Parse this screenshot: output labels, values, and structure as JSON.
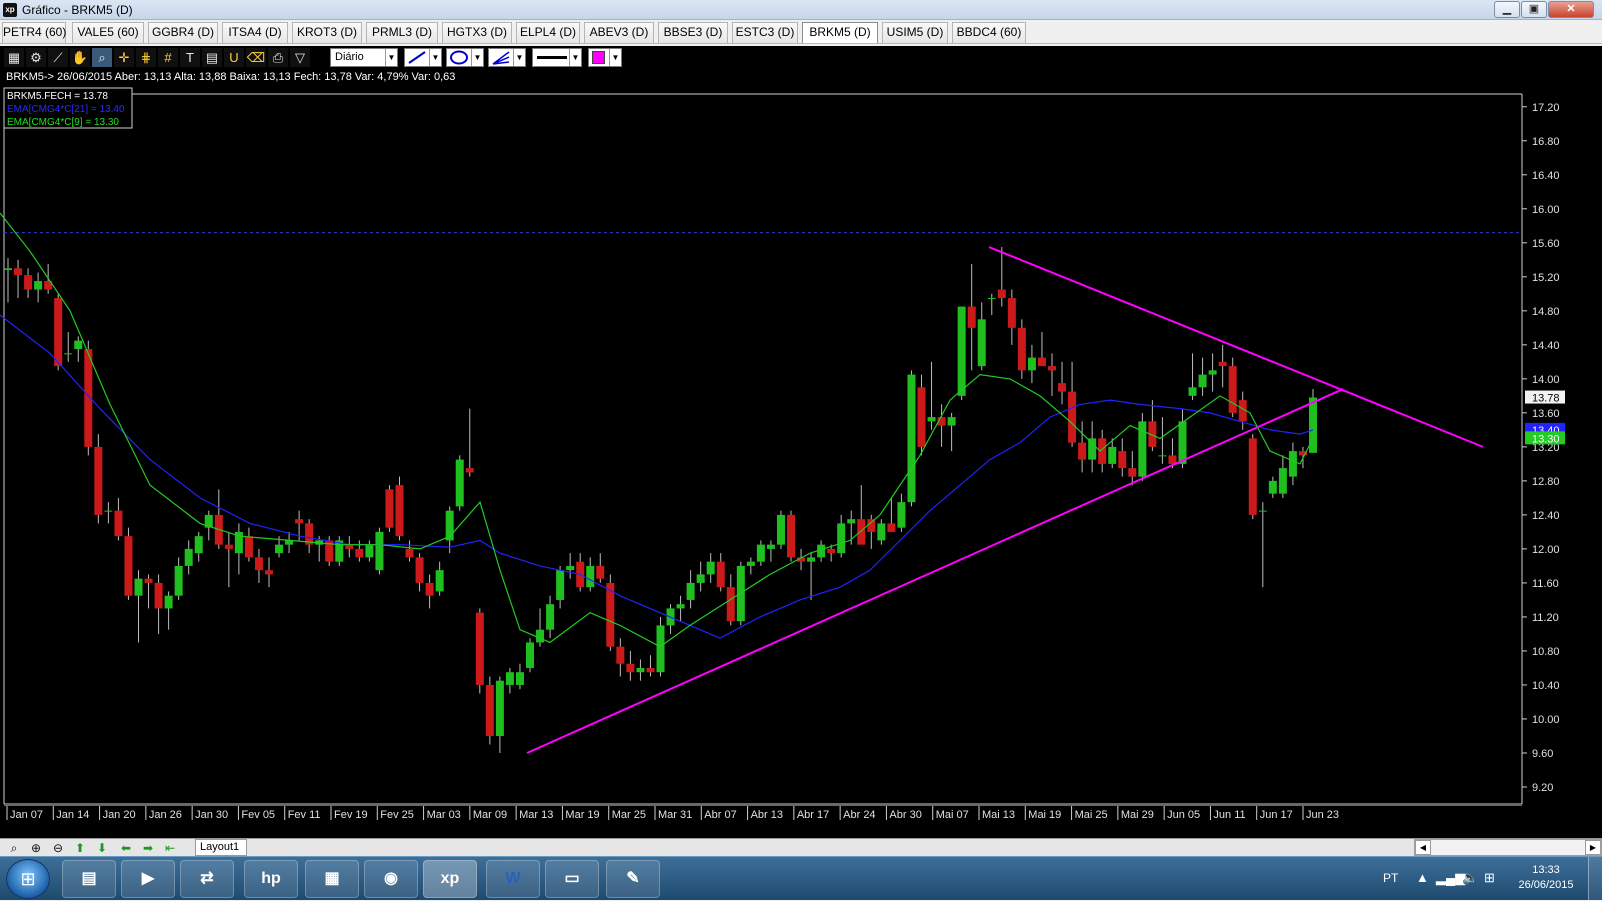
{
  "window": {
    "app_icon_text": "xp",
    "title": "Gráfico - BRKM5 (D)",
    "min_icon": "minimize-icon",
    "max_icon": "maximize-icon",
    "close_icon": "close-icon"
  },
  "tabs": [
    {
      "label": "PETR4 (60)",
      "active": false
    },
    {
      "label": "VALE5 (60)",
      "active": false
    },
    {
      "label": "GGBR4 (D)",
      "active": false
    },
    {
      "label": "ITSA4 (D)",
      "active": false
    },
    {
      "label": "KROT3 (D)",
      "active": false
    },
    {
      "label": "PRML3 (D)",
      "active": false
    },
    {
      "label": "HGTX3 (D)",
      "active": false
    },
    {
      "label": "ELPL4 (D)",
      "active": false
    },
    {
      "label": "ABEV3 (D)",
      "active": false
    },
    {
      "label": "BBSE3 (D)",
      "active": false
    },
    {
      "label": "ESTC3 (D)",
      "active": false
    },
    {
      "label": "BRKM5 (D)",
      "active": true
    },
    {
      "label": "USIM5 (D)",
      "active": false
    },
    {
      "label": "BBDC4 (60)",
      "active": false
    }
  ],
  "toolbar": {
    "period_value": "Diário",
    "line_color": "#ff00ff"
  },
  "info_bar": {
    "text": "BRKM5-> 26/06/2015 Aber: 13,13 Alta: 13,88 Baixa: 13,13 Fech: 13,78 Var: 4,79% Var: 0,63"
  },
  "legend": {
    "items": [
      {
        "text": "BRKM5.FECH = 13.78",
        "color": "#ffffff"
      },
      {
        "text": "EMA[CMG4*C[21] = 13.40",
        "color": "#2b2bff"
      },
      {
        "text": "EMA[CMG4*C[9] = 13.30",
        "color": "#22dd22"
      }
    ]
  },
  "chart_data": {
    "type": "candlestick",
    "symbol": "BRKM5",
    "period": "Diário",
    "ylim": [
      9.0,
      17.35
    ],
    "y_ticks": [
      "17.20",
      "16.80",
      "16.40",
      "16.00",
      "15.60",
      "15.20",
      "14.80",
      "14.40",
      "14.00",
      "13.60",
      "13.20",
      "12.80",
      "12.40",
      "12.00",
      "11.60",
      "11.20",
      "10.80",
      "10.40",
      "10.00",
      "9.60",
      "9.20"
    ],
    "x_labels": [
      "Jan 07",
      "Jan 14",
      "Jan 20",
      "Jan 26",
      "Jan 30",
      "Fev 05",
      "Fev 11",
      "Fev 19",
      "Fev 25",
      "Mar 03",
      "Mar 09",
      "Mar 13",
      "Mar 19",
      "Mar 25",
      "Mar 31",
      "Abr 07",
      "Abr 13",
      "Abr 17",
      "Abr 24",
      "Abr 30",
      "Mai 07",
      "Mai 13",
      "Mai 19",
      "Mai 25",
      "Mai 29",
      "Jun 05",
      "Jun 11",
      "Jun 17",
      "Jun 23"
    ],
    "colors": {
      "up": "#1fbf1f",
      "down": "#cc1a1a",
      "ema21": "#2222ff",
      "ema9": "#22cc22",
      "trendline": "#ff00ff",
      "hline": "#2b3fcf"
    },
    "last_close": "13.78",
    "ema21_label": "13.40",
    "ema9_label": "13.30",
    "resistance_level": 15.72,
    "candles": [
      {
        "o": 15.28,
        "h": 15.42,
        "l": 14.9,
        "c": 15.3
      },
      {
        "o": 15.3,
        "h": 15.4,
        "l": 14.95,
        "c": 15.22
      },
      {
        "o": 15.22,
        "h": 15.3,
        "l": 14.95,
        "c": 15.05
      },
      {
        "o": 15.05,
        "h": 15.25,
        "l": 14.9,
        "c": 15.15
      },
      {
        "o": 15.15,
        "h": 15.35,
        "l": 15.0,
        "c": 15.05
      },
      {
        "o": 14.95,
        "h": 15.0,
        "l": 14.1,
        "c": 14.15
      },
      {
        "o": 14.3,
        "h": 14.55,
        "l": 14.2,
        "c": 14.3
      },
      {
        "o": 14.35,
        "h": 14.5,
        "l": 14.2,
        "c": 14.45
      },
      {
        "o": 14.35,
        "h": 14.45,
        "l": 13.1,
        "c": 13.2
      },
      {
        "o": 13.2,
        "h": 13.35,
        "l": 12.3,
        "c": 12.4
      },
      {
        "o": 12.45,
        "h": 12.55,
        "l": 12.3,
        "c": 12.45
      },
      {
        "o": 12.45,
        "h": 12.6,
        "l": 12.1,
        "c": 12.15
      },
      {
        "o": 12.15,
        "h": 12.25,
        "l": 11.4,
        "c": 11.45
      },
      {
        "o": 11.45,
        "h": 11.75,
        "l": 10.9,
        "c": 11.65
      },
      {
        "o": 11.65,
        "h": 11.7,
        "l": 11.3,
        "c": 11.6
      },
      {
        "o": 11.6,
        "h": 11.7,
        "l": 11.0,
        "c": 11.3
      },
      {
        "o": 11.3,
        "h": 11.5,
        "l": 11.05,
        "c": 11.45
      },
      {
        "o": 11.45,
        "h": 11.9,
        "l": 11.4,
        "c": 11.8
      },
      {
        "o": 11.8,
        "h": 12.1,
        "l": 11.7,
        "c": 12.0
      },
      {
        "o": 11.95,
        "h": 12.2,
        "l": 11.85,
        "c": 12.15
      },
      {
        "o": 12.25,
        "h": 12.45,
        "l": 12.1,
        "c": 12.4
      },
      {
        "o": 12.4,
        "h": 12.7,
        "l": 12.0,
        "c": 12.05
      },
      {
        "o": 12.05,
        "h": 12.2,
        "l": 11.55,
        "c": 12.0
      },
      {
        "o": 11.95,
        "h": 12.3,
        "l": 11.7,
        "c": 12.2
      },
      {
        "o": 12.15,
        "h": 12.25,
        "l": 11.85,
        "c": 11.9
      },
      {
        "o": 11.9,
        "h": 12.0,
        "l": 11.6,
        "c": 11.75
      },
      {
        "o": 11.75,
        "h": 11.9,
        "l": 11.55,
        "c": 11.7
      },
      {
        "o": 11.95,
        "h": 12.15,
        "l": 11.9,
        "c": 12.05
      },
      {
        "o": 12.05,
        "h": 12.2,
        "l": 11.95,
        "c": 12.1
      },
      {
        "o": 12.35,
        "h": 12.45,
        "l": 12.1,
        "c": 12.3
      },
      {
        "o": 12.3,
        "h": 12.35,
        "l": 11.95,
        "c": 12.05
      },
      {
        "o": 12.05,
        "h": 12.15,
        "l": 11.85,
        "c": 12.1
      },
      {
        "o": 12.1,
        "h": 12.15,
        "l": 11.8,
        "c": 11.85
      },
      {
        "o": 11.85,
        "h": 12.15,
        "l": 11.8,
        "c": 12.1
      },
      {
        "o": 12.05,
        "h": 12.15,
        "l": 11.9,
        "c": 12.0
      },
      {
        "o": 12.0,
        "h": 12.1,
        "l": 11.85,
        "c": 11.9
      },
      {
        "o": 11.9,
        "h": 12.1,
        "l": 11.85,
        "c": 12.05
      },
      {
        "o": 11.75,
        "h": 12.25,
        "l": 11.7,
        "c": 12.2
      },
      {
        "o": 12.7,
        "h": 12.75,
        "l": 12.2,
        "c": 12.25
      },
      {
        "o": 12.75,
        "h": 12.85,
        "l": 12.1,
        "c": 12.15
      },
      {
        "o": 12.0,
        "h": 12.1,
        "l": 11.85,
        "c": 11.9
      },
      {
        "o": 11.9,
        "h": 11.95,
        "l": 11.5,
        "c": 11.6
      },
      {
        "o": 11.6,
        "h": 11.7,
        "l": 11.3,
        "c": 11.45
      },
      {
        "o": 11.5,
        "h": 11.85,
        "l": 11.45,
        "c": 11.75
      },
      {
        "o": 12.1,
        "h": 12.5,
        "l": 11.95,
        "c": 12.45
      },
      {
        "o": 12.5,
        "h": 13.1,
        "l": 12.45,
        "c": 13.05
      },
      {
        "o": 12.95,
        "h": 13.65,
        "l": 12.85,
        "c": 12.9
      },
      {
        "o": 11.25,
        "h": 11.3,
        "l": 10.3,
        "c": 10.4
      },
      {
        "o": 10.4,
        "h": 10.5,
        "l": 9.7,
        "c": 9.8
      },
      {
        "o": 9.8,
        "h": 10.5,
        "l": 9.6,
        "c": 10.45
      },
      {
        "o": 10.4,
        "h": 10.6,
        "l": 10.3,
        "c": 10.55
      },
      {
        "o": 10.4,
        "h": 10.65,
        "l": 10.35,
        "c": 10.55
      },
      {
        "o": 10.6,
        "h": 10.95,
        "l": 10.55,
        "c": 10.9
      },
      {
        "o": 10.9,
        "h": 11.3,
        "l": 10.85,
        "c": 11.05
      },
      {
        "o": 11.05,
        "h": 11.45,
        "l": 10.95,
        "c": 11.35
      },
      {
        "o": 11.4,
        "h": 11.8,
        "l": 11.3,
        "c": 11.75
      },
      {
        "o": 11.75,
        "h": 11.95,
        "l": 11.65,
        "c": 11.8
      },
      {
        "o": 11.85,
        "h": 11.95,
        "l": 11.5,
        "c": 11.55
      },
      {
        "o": 11.55,
        "h": 11.9,
        "l": 11.5,
        "c": 11.8
      },
      {
        "o": 11.8,
        "h": 11.95,
        "l": 11.6,
        "c": 11.65
      },
      {
        "o": 11.6,
        "h": 11.7,
        "l": 10.8,
        "c": 10.85
      },
      {
        "o": 10.85,
        "h": 10.95,
        "l": 10.5,
        "c": 10.65
      },
      {
        "o": 10.65,
        "h": 10.8,
        "l": 10.45,
        "c": 10.55
      },
      {
        "o": 10.55,
        "h": 10.7,
        "l": 10.45,
        "c": 10.6
      },
      {
        "o": 10.6,
        "h": 10.75,
        "l": 10.5,
        "c": 10.55
      },
      {
        "o": 10.55,
        "h": 11.2,
        "l": 10.5,
        "c": 11.1
      },
      {
        "o": 11.1,
        "h": 11.35,
        "l": 11.0,
        "c": 11.3
      },
      {
        "o": 11.3,
        "h": 11.45,
        "l": 11.15,
        "c": 11.35
      },
      {
        "o": 11.4,
        "h": 11.75,
        "l": 11.3,
        "c": 11.6
      },
      {
        "o": 11.6,
        "h": 11.85,
        "l": 11.5,
        "c": 11.7
      },
      {
        "o": 11.7,
        "h": 11.95,
        "l": 11.6,
        "c": 11.85
      },
      {
        "o": 11.85,
        "h": 11.95,
        "l": 11.5,
        "c": 11.55
      },
      {
        "o": 11.55,
        "h": 11.7,
        "l": 11.1,
        "c": 11.15
      },
      {
        "o": 11.15,
        "h": 11.85,
        "l": 11.1,
        "c": 11.8
      },
      {
        "o": 11.8,
        "h": 11.9,
        "l": 11.7,
        "c": 11.85
      },
      {
        "o": 11.85,
        "h": 12.1,
        "l": 11.8,
        "c": 12.05
      },
      {
        "o": 12.0,
        "h": 12.1,
        "l": 11.85,
        "c": 12.05
      },
      {
        "o": 12.05,
        "h": 12.45,
        "l": 12.0,
        "c": 12.4
      },
      {
        "o": 12.4,
        "h": 12.45,
        "l": 11.85,
        "c": 11.9
      },
      {
        "o": 11.9,
        "h": 12.0,
        "l": 11.75,
        "c": 11.85
      },
      {
        "o": 11.85,
        "h": 11.95,
        "l": 11.4,
        "c": 11.9
      },
      {
        "o": 11.9,
        "h": 12.1,
        "l": 11.85,
        "c": 12.05
      },
      {
        "o": 12.0,
        "h": 12.05,
        "l": 11.85,
        "c": 11.95
      },
      {
        "o": 11.95,
        "h": 12.4,
        "l": 11.9,
        "c": 12.3
      },
      {
        "o": 12.3,
        "h": 12.45,
        "l": 12.05,
        "c": 12.35
      },
      {
        "o": 12.35,
        "h": 12.75,
        "l": 12.3,
        "c": 12.05
      },
      {
        "o": 12.35,
        "h": 12.4,
        "l": 12.0,
        "c": 12.2
      },
      {
        "o": 12.1,
        "h": 12.35,
        "l": 12.05,
        "c": 12.3
      },
      {
        "o": 12.3,
        "h": 12.6,
        "l": 12.25,
        "c": 12.2
      },
      {
        "o": 12.25,
        "h": 12.65,
        "l": 12.2,
        "c": 12.55
      },
      {
        "o": 12.55,
        "h": 14.1,
        "l": 12.5,
        "c": 14.05
      },
      {
        "o": 13.9,
        "h": 14.05,
        "l": 13.1,
        "c": 13.2
      },
      {
        "o": 13.5,
        "h": 14.2,
        "l": 13.4,
        "c": 13.55
      },
      {
        "o": 13.55,
        "h": 13.7,
        "l": 13.2,
        "c": 13.45
      },
      {
        "o": 13.45,
        "h": 13.6,
        "l": 13.15,
        "c": 13.55
      },
      {
        "o": 13.8,
        "h": 14.85,
        "l": 13.75,
        "c": 14.85
      },
      {
        "o": 14.85,
        "h": 15.35,
        "l": 14.1,
        "c": 14.6
      },
      {
        "o": 14.15,
        "h": 14.9,
        "l": 14.1,
        "c": 14.7
      },
      {
        "o": 14.95,
        "h": 15.0,
        "l": 14.75,
        "c": 14.95
      },
      {
        "o": 15.05,
        "h": 15.55,
        "l": 14.85,
        "c": 14.95
      },
      {
        "o": 14.95,
        "h": 15.05,
        "l": 14.4,
        "c": 14.6
      },
      {
        "o": 14.6,
        "h": 14.7,
        "l": 14.0,
        "c": 14.1
      },
      {
        "o": 14.1,
        "h": 14.4,
        "l": 13.95,
        "c": 14.25
      },
      {
        "o": 14.25,
        "h": 14.55,
        "l": 14.15,
        "c": 14.15
      },
      {
        "o": 14.15,
        "h": 14.3,
        "l": 13.8,
        "c": 14.1
      },
      {
        "o": 13.95,
        "h": 14.2,
        "l": 13.7,
        "c": 13.85
      },
      {
        "o": 13.85,
        "h": 14.2,
        "l": 13.2,
        "c": 13.25
      },
      {
        "o": 13.25,
        "h": 13.5,
        "l": 12.9,
        "c": 13.05
      },
      {
        "o": 13.05,
        "h": 13.5,
        "l": 12.9,
        "c": 13.3
      },
      {
        "o": 13.3,
        "h": 13.4,
        "l": 12.9,
        "c": 13.0
      },
      {
        "o": 13.0,
        "h": 13.3,
        "l": 12.95,
        "c": 13.2
      },
      {
        "o": 13.15,
        "h": 13.3,
        "l": 12.85,
        "c": 12.95
      },
      {
        "o": 12.95,
        "h": 13.15,
        "l": 12.75,
        "c": 12.85
      },
      {
        "o": 12.85,
        "h": 13.6,
        "l": 12.8,
        "c": 13.5
      },
      {
        "o": 13.5,
        "h": 13.75,
        "l": 13.15,
        "c": 13.2
      },
      {
        "o": 13.1,
        "h": 13.55,
        "l": 13.0,
        "c": 13.1
      },
      {
        "o": 13.1,
        "h": 13.3,
        "l": 12.95,
        "c": 13.0
      },
      {
        "o": 13.0,
        "h": 13.65,
        "l": 12.95,
        "c": 13.5
      },
      {
        "o": 13.8,
        "h": 14.3,
        "l": 13.75,
        "c": 13.9
      },
      {
        "o": 13.9,
        "h": 14.25,
        "l": 13.8,
        "c": 14.05
      },
      {
        "o": 14.05,
        "h": 14.3,
        "l": 13.85,
        "c": 14.1
      },
      {
        "o": 14.2,
        "h": 14.4,
        "l": 13.9,
        "c": 14.15
      },
      {
        "o": 14.15,
        "h": 14.25,
        "l": 13.55,
        "c": 13.6
      },
      {
        "o": 13.75,
        "h": 13.85,
        "l": 13.4,
        "c": 13.5
      },
      {
        "o": 13.3,
        "h": 13.35,
        "l": 12.35,
        "c": 12.4
      },
      {
        "o": 12.45,
        "h": 12.55,
        "l": 11.55,
        "c": 12.45
      },
      {
        "o": 12.65,
        "h": 12.85,
        "l": 12.6,
        "c": 12.8
      },
      {
        "o": 12.65,
        "h": 13.1,
        "l": 12.6,
        "c": 12.95
      },
      {
        "o": 12.85,
        "h": 13.25,
        "l": 12.75,
        "c": 13.15
      },
      {
        "o": 13.15,
        "h": 13.2,
        "l": 12.95,
        "c": 13.1
      },
      {
        "o": 13.13,
        "h": 13.88,
        "l": 13.13,
        "c": 13.78
      }
    ],
    "ema21": [
      [
        0,
        14.75
      ],
      [
        50,
        14.3
      ],
      [
        100,
        13.65
      ],
      [
        150,
        13.05
      ],
      [
        200,
        12.6
      ],
      [
        250,
        12.3
      ],
      [
        300,
        12.15
      ],
      [
        350,
        12.05
      ],
      [
        400,
        12.05
      ],
      [
        450,
        12.02
      ],
      [
        480,
        12.1
      ],
      [
        500,
        11.95
      ],
      [
        540,
        11.8
      ],
      [
        580,
        11.7
      ],
      [
        620,
        11.45
      ],
      [
        660,
        11.25
      ],
      [
        690,
        11.1
      ],
      [
        720,
        10.95
      ],
      [
        760,
        11.2
      ],
      [
        800,
        11.4
      ],
      [
        840,
        11.55
      ],
      [
        870,
        11.75
      ],
      [
        900,
        12.1
      ],
      [
        930,
        12.45
      ],
      [
        960,
        12.75
      ],
      [
        990,
        13.05
      ],
      [
        1020,
        13.25
      ],
      [
        1050,
        13.55
      ],
      [
        1080,
        13.7
      ],
      [
        1110,
        13.75
      ],
      [
        1140,
        13.7
      ],
      [
        1180,
        13.65
      ],
      [
        1210,
        13.6
      ],
      [
        1240,
        13.5
      ],
      [
        1270,
        13.4
      ],
      [
        1300,
        13.35
      ],
      [
        1313,
        13.4
      ]
    ],
    "ema9": [
      [
        0,
        15.95
      ],
      [
        30,
        15.5
      ],
      [
        70,
        14.8
      ],
      [
        110,
        13.7
      ],
      [
        150,
        12.75
      ],
      [
        200,
        12.3
      ],
      [
        240,
        12.15
      ],
      [
        290,
        12.1
      ],
      [
        340,
        12.05
      ],
      [
        380,
        12.05
      ],
      [
        420,
        12.0
      ],
      [
        450,
        12.15
      ],
      [
        480,
        12.55
      ],
      [
        500,
        11.75
      ],
      [
        520,
        11.05
      ],
      [
        550,
        10.9
      ],
      [
        590,
        11.25
      ],
      [
        620,
        11.1
      ],
      [
        660,
        10.85
      ],
      [
        690,
        11.1
      ],
      [
        730,
        11.4
      ],
      [
        770,
        11.7
      ],
      [
        810,
        11.95
      ],
      [
        850,
        12.1
      ],
      [
        880,
        12.4
      ],
      [
        920,
        13.1
      ],
      [
        950,
        13.75
      ],
      [
        980,
        14.05
      ],
      [
        1010,
        14.0
      ],
      [
        1040,
        13.8
      ],
      [
        1070,
        13.5
      ],
      [
        1100,
        13.15
      ],
      [
        1130,
        13.45
      ],
      [
        1160,
        13.3
      ],
      [
        1190,
        13.55
      ],
      [
        1220,
        13.8
      ],
      [
        1250,
        13.6
      ],
      [
        1270,
        13.15
      ],
      [
        1300,
        13.0
      ],
      [
        1313,
        13.3
      ]
    ]
  },
  "navbar": {
    "layout_label": "Layout1"
  },
  "taskbar": {
    "apps": [
      {
        "icon": "folder-icon",
        "glyph": "▤"
      },
      {
        "icon": "media-player-icon",
        "glyph": "▶"
      },
      {
        "icon": "network-icon",
        "glyph": "⇄"
      },
      {
        "icon": "hp-icon",
        "glyph": "hp"
      },
      {
        "icon": "image-tool-icon",
        "glyph": "▦"
      },
      {
        "icon": "chrome-icon",
        "glyph": "◉"
      },
      {
        "icon": "xp-app-icon",
        "glyph": "xp"
      },
      {
        "icon": "word-icon",
        "glyph": "W"
      },
      {
        "icon": "photo-viewer-icon",
        "glyph": "▭"
      },
      {
        "icon": "paint-icon",
        "glyph": "✎"
      }
    ],
    "lang": "PT",
    "time": "13:33",
    "date": "26/06/2015"
  }
}
